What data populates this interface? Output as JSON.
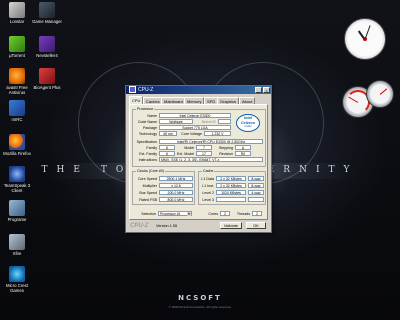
{
  "desktop": {
    "icons": [
      {
        "label": "Lonstar",
        "icon": "lonstar-icon"
      },
      {
        "label": "µTorrent",
        "icon": "utorrent-icon"
      },
      {
        "label": "avast! Free Antivirus",
        "icon": "avast-icon"
      },
      {
        "label": "mIRC",
        "icon": "mirc-icon"
      },
      {
        "label": "Mozilla Firefox",
        "icon": "firefox-icon"
      },
      {
        "label": "TeamSpeak 3 Client",
        "icon": "teamspeak-icon"
      },
      {
        "label": "Programe",
        "icon": "programe-icon"
      },
      {
        "label": "Xfire",
        "icon": "xfire-icon"
      },
      {
        "label": "Micro Crest Games",
        "icon": "micro-crest-icon"
      },
      {
        "label": "Game Manager",
        "icon": "game-manager-icon"
      },
      {
        "label": "Nevsteller4",
        "icon": "nevsteller-icon"
      },
      {
        "label": "BioAgent Plus",
        "icon": "bioagent-icon"
      }
    ],
    "wallpaper_title": "THE TOWER OF ETERNITY",
    "wallpaper_brand": "NCSOFT",
    "wallpaper_copyright": "© 2009 NCsoft Corporation. All rights reserved."
  },
  "cpuz": {
    "title": "CPU-Z",
    "tabs": [
      "CPU",
      "Caches",
      "Mainboard",
      "Memory",
      "SPD",
      "Graphics",
      "About"
    ],
    "active_tab": "CPU",
    "processor": {
      "group_label": "Processor",
      "name_label": "Name",
      "name": "Intel Celeron E3300",
      "codename_label": "Code Name",
      "codename": "Wolfdale",
      "brandid_label": "Brand ID",
      "brandid": "",
      "package_label": "Package",
      "package": "Socket 775 LGA",
      "technology_label": "Technology",
      "technology": "45 nm",
      "corevoltage_label": "Core Voltage",
      "corevoltage": "1.232 V",
      "spec_label": "Specification",
      "spec": "Intel(R) Celeron(R) CPU      E3300  @ 2.50GHz",
      "family_label": "Family",
      "family": "6",
      "model_label": "Model",
      "model": "7",
      "stepping_label": "Stepping",
      "stepping": "A",
      "extfamily_label": "Ext. Family",
      "extfamily": "6",
      "extmodel_label": "Ext. Model",
      "extmodel": "17",
      "revision_label": "Revision",
      "revision": "R0",
      "instructions_label": "Instructions",
      "instructions": "MMX, SSE (1, 2, 3, 3S), EM64T, VT-x"
    },
    "logo": {
      "brand": "intel",
      "line1": "Celeron",
      "line2": "inside"
    },
    "clocks": {
      "group_label": "Clocks (Core #0)",
      "corespeed_label": "Core Speed",
      "corespeed": "2500.1 MHz",
      "multiplier_label": "Multiplier",
      "multiplier": "x 12.5",
      "busspeed_label": "Bus Speed",
      "busspeed": "200.0 MHz",
      "ratedfsb_label": "Rated FSB",
      "ratedfsb": "800.0 MHz"
    },
    "cache": {
      "group_label": "Cache",
      "l1d_label": "L1 Data",
      "l1d": "2 x 32 KBytes",
      "l1d_way": "8-way",
      "l1i_label": "L1 Inst.",
      "l1i": "2 x 32 KBytes",
      "l1i_way": "8-way",
      "l2_label": "Level 2",
      "l2": "1024 KBytes",
      "l2_way": "4-way",
      "l3_label": "Level 3",
      "l3": "",
      "l3_way": ""
    },
    "selection_label": "Selection",
    "selection_value": "Processor #1",
    "cores_label": "Cores",
    "cores": "2",
    "threads_label": "Threads",
    "threads": "2",
    "footer_brand": "CPU-Z",
    "version": "Version 1.55",
    "validate_label": "Validate",
    "ok_label": "OK"
  }
}
